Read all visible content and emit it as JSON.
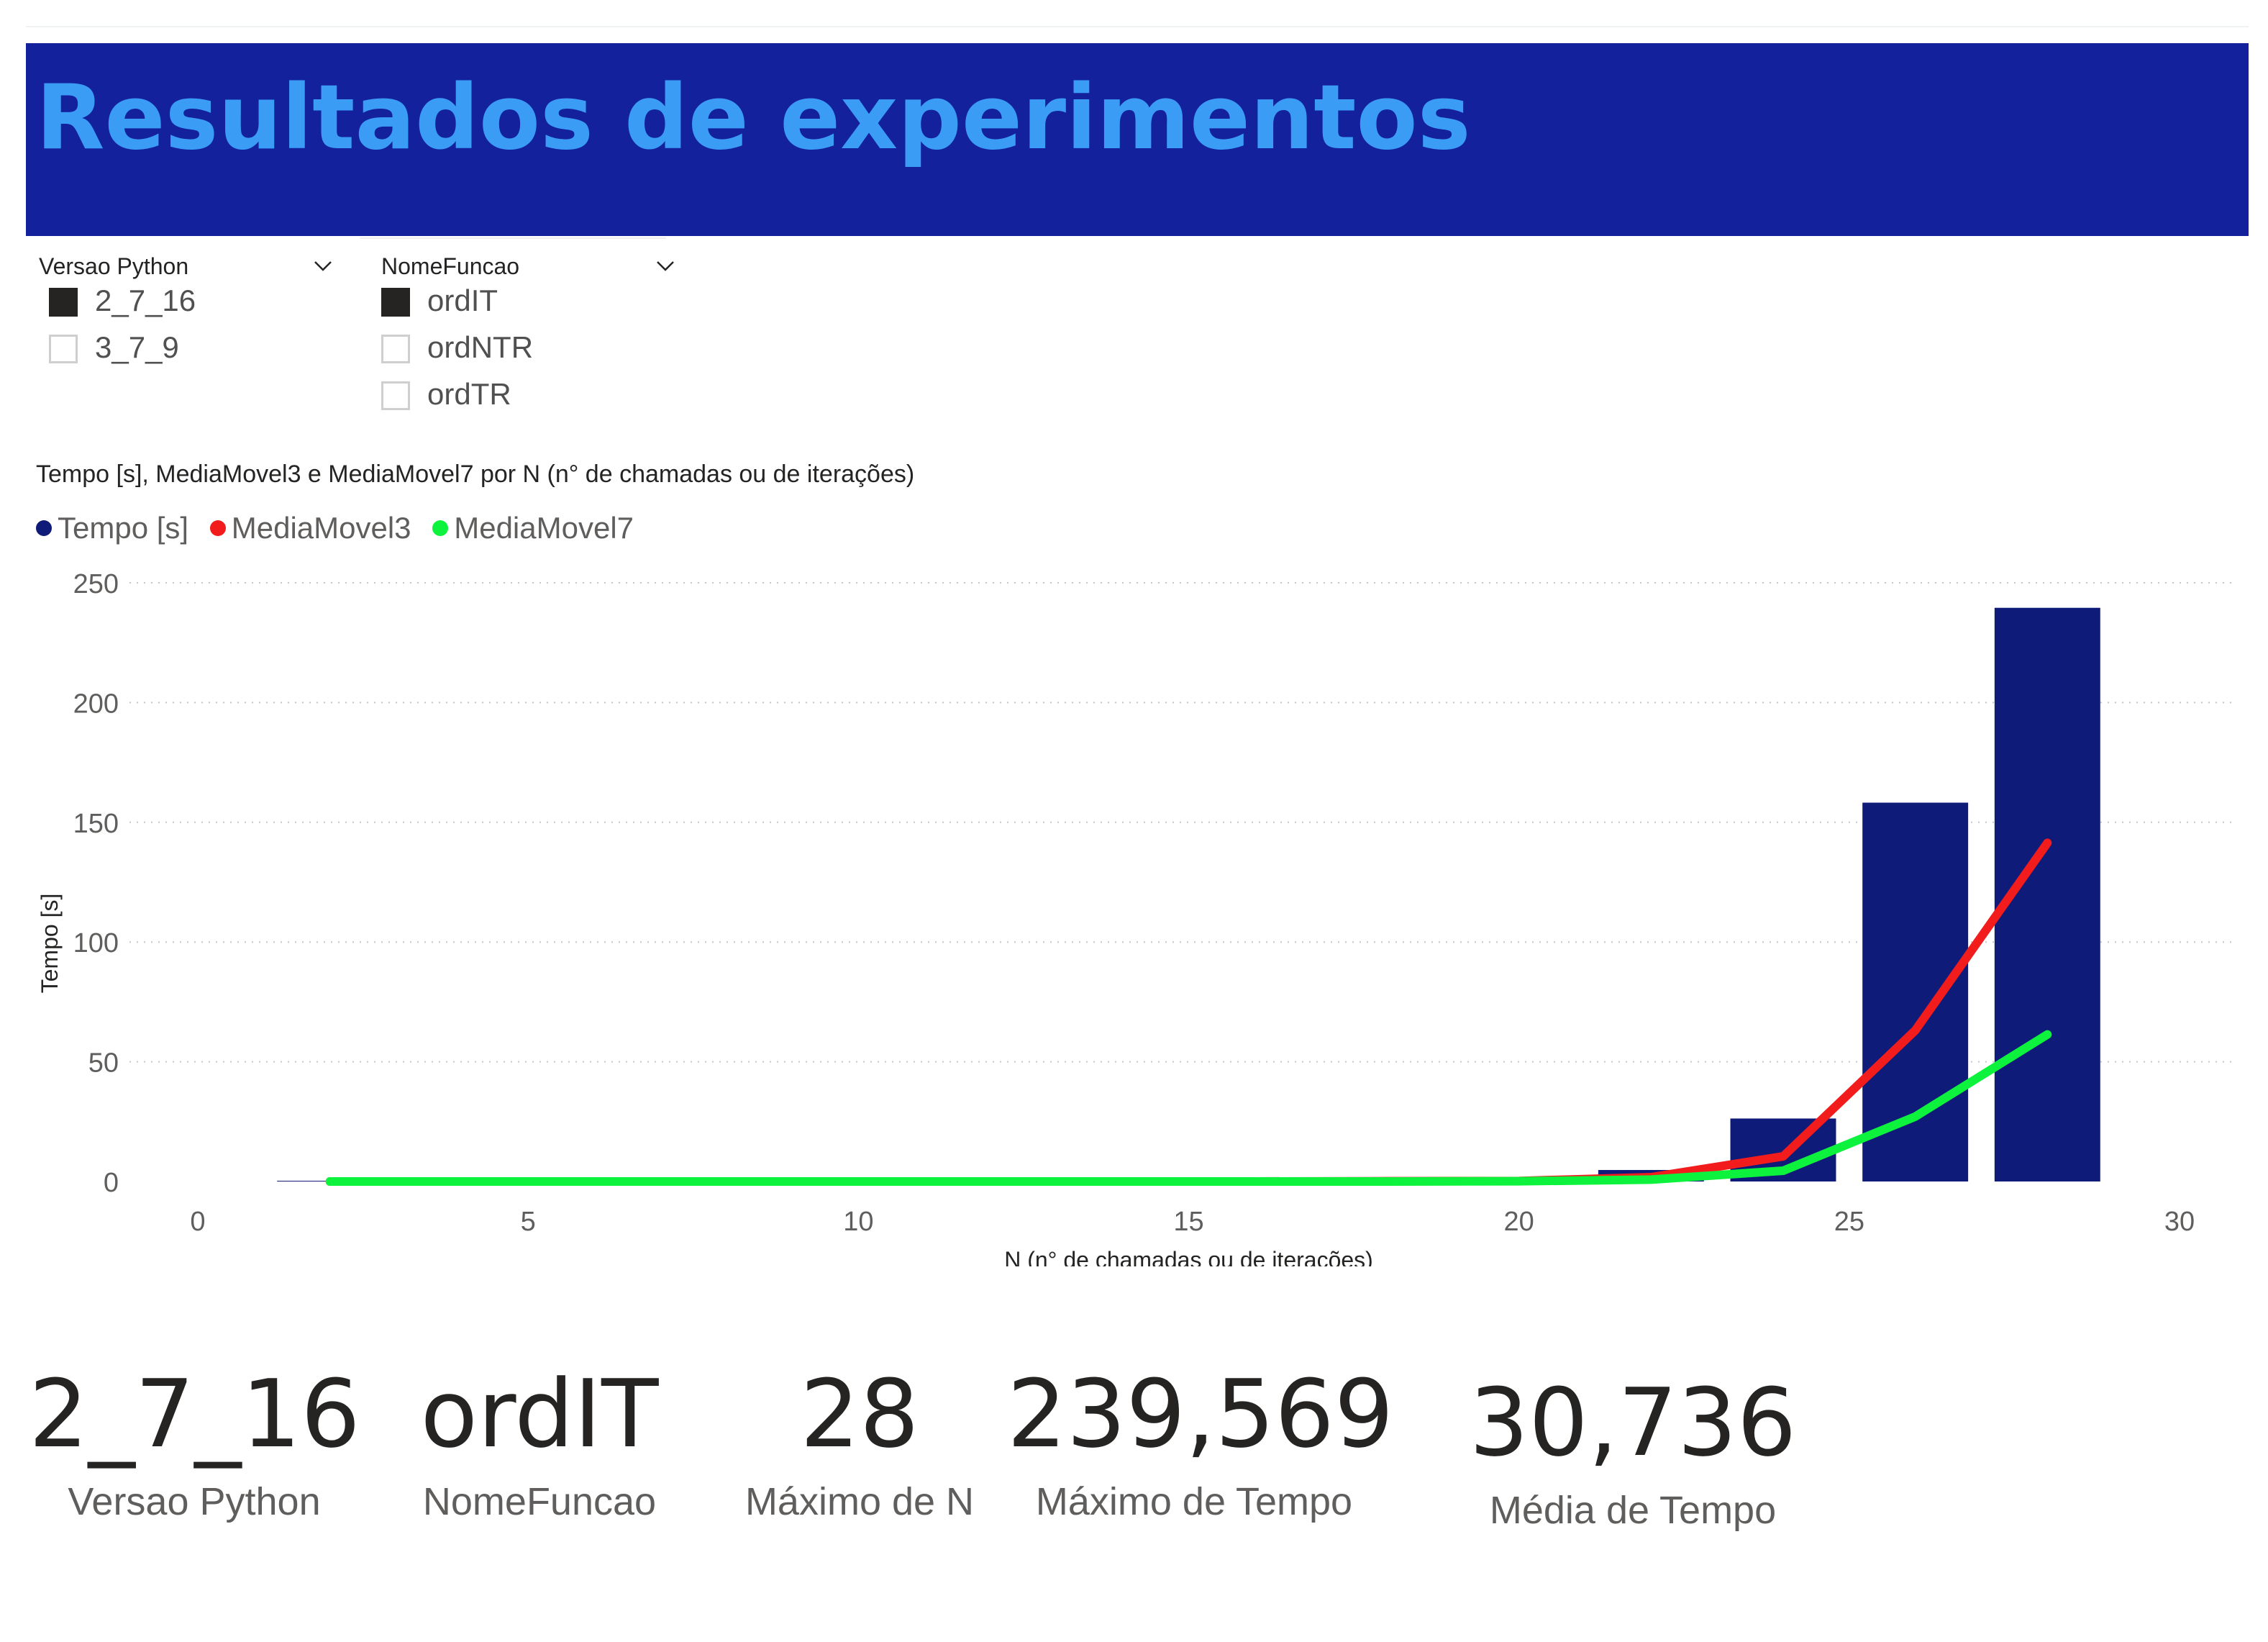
{
  "header": {
    "title": "Resultados de experimentos"
  },
  "slicers": {
    "versao": {
      "title": "Versao Python",
      "options": [
        {
          "label": "2_7_16",
          "checked": true
        },
        {
          "label": "3_7_9",
          "checked": false
        }
      ]
    },
    "funcao": {
      "title": "NomeFuncao",
      "options": [
        {
          "label": "ordIT",
          "checked": true
        },
        {
          "label": "ordNTR",
          "checked": false
        },
        {
          "label": "ordTR",
          "checked": false
        }
      ]
    }
  },
  "chart_data": {
    "type": "bar",
    "title": "Tempo [s], MediaMovel3 e MediaMovel7 por N (n° de chamadas ou de iterações)",
    "xlabel": "N (n° de chamadas ou de iterações)",
    "ylabel": "Tempo [s]",
    "xlim": [
      0,
      30
    ],
    "ylim": [
      0,
      250
    ],
    "xticks": [
      "0",
      "5",
      "10",
      "15",
      "20",
      "25",
      "30"
    ],
    "yticks": [
      "0",
      "50",
      "100",
      "150",
      "200",
      "250"
    ],
    "grid": true,
    "legend_position": "top-left",
    "bars": {
      "name": "Tempo [s]",
      "color": "#0f1b78",
      "x": [
        2,
        4,
        6,
        8,
        10,
        12,
        14,
        16,
        18,
        20,
        22,
        24,
        26,
        28
      ],
      "values": [
        0,
        0,
        0,
        0,
        0,
        0,
        0,
        0,
        0.1,
        0.5,
        4.8,
        26.3,
        158.2,
        239.569
      ]
    },
    "lines": [
      {
        "name": "MediaMovel3",
        "color": "#f21c1c",
        "x": [
          2,
          4,
          6,
          8,
          10,
          12,
          14,
          16,
          18,
          20,
          22,
          24,
          26,
          28
        ],
        "values": [
          0,
          0,
          0,
          0,
          0,
          0,
          0,
          0,
          0.1,
          0.2,
          1.8,
          10.5,
          63.1,
          141.4
        ]
      },
      {
        "name": "MediaMovel7",
        "color": "#0df23c",
        "x": [
          2,
          4,
          6,
          8,
          10,
          12,
          14,
          16,
          18,
          20,
          22,
          24,
          26,
          28
        ],
        "values": [
          0,
          0,
          0,
          0,
          0,
          0,
          0,
          0,
          0,
          0.1,
          0.8,
          4.5,
          27.1,
          61.4
        ]
      }
    ]
  },
  "kpis": [
    {
      "value": "2_7_16",
      "label": "Versao Python"
    },
    {
      "value": "ordIT",
      "label": "NomeFuncao"
    },
    {
      "value": "28",
      "label": "Máximo de N"
    },
    {
      "value": "239,569",
      "label": "Máximo de Tempo"
    },
    {
      "value": "30,736",
      "label": "Média de Tempo"
    }
  ]
}
